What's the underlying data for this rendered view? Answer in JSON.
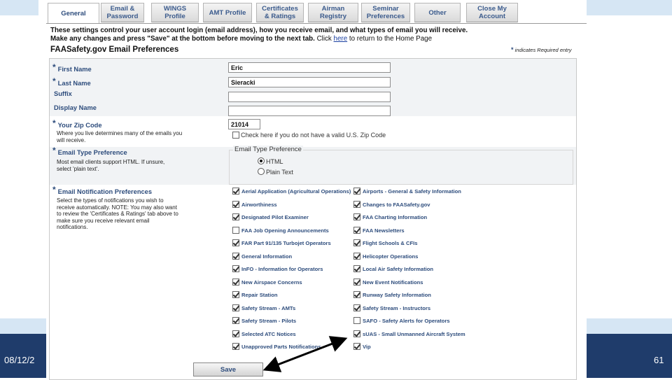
{
  "slide": {
    "date": "08/12/2",
    "page_number": "61"
  },
  "tabs": [
    {
      "label": "General",
      "active": true
    },
    {
      "label": "Email &\nPassword"
    },
    {
      "label": "WINGS\nProfile"
    },
    {
      "label": "AMT Profile"
    },
    {
      "label": "Certificates\n& Ratings"
    },
    {
      "label": "Airman\nRegistry"
    },
    {
      "label": "Seminar\nPreferences"
    },
    {
      "label": "Other"
    },
    {
      "label": "Close My\nAccount"
    }
  ],
  "intro": {
    "text_bold": "These settings control your user account login (email address), how you receive email, and what types of email you will receive. Make any changes and press \"Save\" at the bottom before moving to the next tab.",
    "link_prefix": " Click ",
    "link_text": "here",
    "link_suffix": " to return to the Home Page"
  },
  "section_title": "FAASafety.gov Email Preferences",
  "required_note": "indicates Required entry",
  "fields": {
    "first_name": {
      "label": "First Name",
      "value": "Eric"
    },
    "last_name": {
      "label": "Last Name",
      "value": "Sieracki"
    },
    "suffix": {
      "label": "Suffix",
      "value": ""
    },
    "display_name": {
      "label": "Display Name",
      "value": ""
    },
    "zip": {
      "label": "Your Zip Code",
      "value": "21014",
      "hint": "Where you live determines many of the emails you will receive.",
      "no_zip_label": "Check here if you do not have a valid U.S. Zip Code"
    },
    "email_type": {
      "label": "Email Type Preference",
      "hint": "Most email clients support HTML. If unsure, select 'plain text'.",
      "legend": "Email Type Preference",
      "options": [
        "HTML",
        "Plain Text"
      ],
      "selected": "HTML"
    },
    "notifications": {
      "label": "Email Notification Preferences",
      "hint": "Select the types of notifications you wish to receive automatically. NOTE: You may also want to review the 'Certificates & Ratings' tab above to make sure you receive relevant email notifications."
    }
  },
  "notification_options_left": [
    {
      "label": "Aerial Application (Agricultural Operations)",
      "checked": true
    },
    {
      "label": "Airworthiness",
      "checked": true
    },
    {
      "label": "Designated Pilot Examiner",
      "checked": true
    },
    {
      "label": "FAA Job Opening Announcements",
      "checked": false
    },
    {
      "label": "FAR Part 91/135 Turbojet Operators",
      "checked": true
    },
    {
      "label": "General Information",
      "checked": true
    },
    {
      "label": "InFO - Information for Operators",
      "checked": true
    },
    {
      "label": "New Airspace Concerns",
      "checked": true
    },
    {
      "label": "Repair Station",
      "checked": true
    },
    {
      "label": "Safety Stream - AMTs",
      "checked": true
    },
    {
      "label": "Safety Stream - Pilots",
      "checked": true
    },
    {
      "label": "Selected ATC Notices",
      "checked": true
    },
    {
      "label": "Unapproved Parts Notifications",
      "checked": true
    }
  ],
  "notification_options_right": [
    {
      "label": "Airports - General & Safety Information",
      "checked": true
    },
    {
      "label": "Changes to FAASafety.gov",
      "checked": true
    },
    {
      "label": "FAA Charting Information",
      "checked": true
    },
    {
      "label": "FAA Newsletters",
      "checked": true
    },
    {
      "label": "Flight Schools & CFIs",
      "checked": true
    },
    {
      "label": "Helicopter Operations",
      "checked": true
    },
    {
      "label": "Local Air Safety Information",
      "checked": true
    },
    {
      "label": "New Event Notifications",
      "checked": true
    },
    {
      "label": "Runway Safety Information",
      "checked": true
    },
    {
      "label": "Safety Stream - Instructors",
      "checked": true
    },
    {
      "label": "SAFO - Safety Alerts for Operators",
      "checked": false
    },
    {
      "label": "sUAS - Small Unmanned Aircraft System",
      "checked": true
    },
    {
      "label": "Vip",
      "checked": true
    }
  ],
  "save_button": "Save",
  "colors": {
    "slide_band": "#1f3c6b",
    "label_blue": "#2d4c7c",
    "row_gray": "#f1f3f5"
  }
}
